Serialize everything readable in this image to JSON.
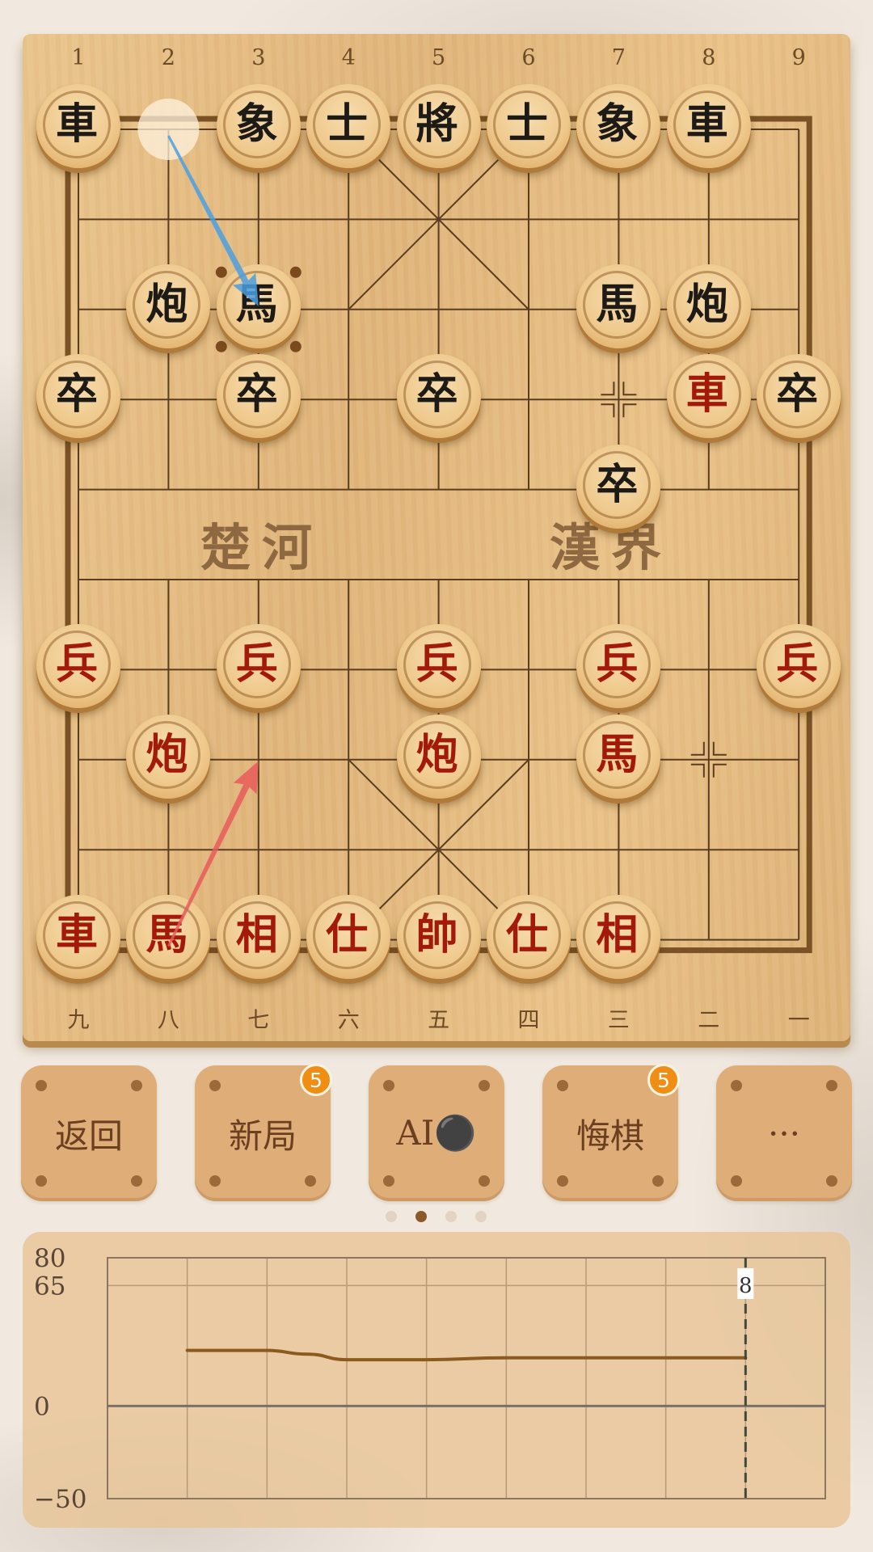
{
  "board": {
    "file_labels_top": [
      "1",
      "2",
      "3",
      "4",
      "5",
      "6",
      "7",
      "8",
      "9"
    ],
    "file_labels_bottom": [
      "九",
      "八",
      "七",
      "六",
      "五",
      "四",
      "三",
      "二",
      "一"
    ],
    "river_left": "楚河",
    "river_right": "漢界",
    "pieces": [
      {
        "char": "車",
        "side": "black",
        "file": 0,
        "rank": 0
      },
      {
        "char": "象",
        "side": "black",
        "file": 2,
        "rank": 0
      },
      {
        "char": "士",
        "side": "black",
        "file": 3,
        "rank": 0
      },
      {
        "char": "將",
        "side": "black",
        "file": 4,
        "rank": 0
      },
      {
        "char": "士",
        "side": "black",
        "file": 5,
        "rank": 0
      },
      {
        "char": "象",
        "side": "black",
        "file": 6,
        "rank": 0
      },
      {
        "char": "車",
        "side": "black",
        "file": 7,
        "rank": 0
      },
      {
        "char": "炮",
        "side": "black",
        "file": 1,
        "rank": 2
      },
      {
        "char": "馬",
        "side": "black",
        "file": 2,
        "rank": 2
      },
      {
        "char": "馬",
        "side": "black",
        "file": 6,
        "rank": 2
      },
      {
        "char": "炮",
        "side": "black",
        "file": 7,
        "rank": 2
      },
      {
        "char": "卒",
        "side": "black",
        "file": 0,
        "rank": 3
      },
      {
        "char": "卒",
        "side": "black",
        "file": 2,
        "rank": 3
      },
      {
        "char": "卒",
        "side": "black",
        "file": 4,
        "rank": 3
      },
      {
        "char": "車",
        "side": "red-black",
        "file": 7,
        "rank": 3
      },
      {
        "char": "卒",
        "side": "black",
        "file": 8,
        "rank": 3
      },
      {
        "char": "卒",
        "side": "black",
        "file": 6,
        "rank": 4
      },
      {
        "char": "兵",
        "side": "red",
        "file": 0,
        "rank": 6
      },
      {
        "char": "兵",
        "side": "red",
        "file": 2,
        "rank": 6
      },
      {
        "char": "兵",
        "side": "red",
        "file": 4,
        "rank": 6
      },
      {
        "char": "兵",
        "side": "red",
        "file": 6,
        "rank": 6
      },
      {
        "char": "兵",
        "side": "red",
        "file": 8,
        "rank": 6
      },
      {
        "char": "炮",
        "side": "red",
        "file": 1,
        "rank": 7
      },
      {
        "char": "炮",
        "side": "red",
        "file": 4,
        "rank": 7
      },
      {
        "char": "馬",
        "side": "red",
        "file": 6,
        "rank": 7
      },
      {
        "char": "車",
        "side": "red",
        "file": 0,
        "rank": 9
      },
      {
        "char": "馬",
        "side": "red",
        "file": 1,
        "rank": 9
      },
      {
        "char": "相",
        "side": "red",
        "file": 2,
        "rank": 9
      },
      {
        "char": "仕",
        "side": "red",
        "file": 3,
        "rank": 9
      },
      {
        "char": "帥",
        "side": "red",
        "file": 4,
        "rank": 9
      },
      {
        "char": "仕",
        "side": "red",
        "file": 5,
        "rank": 9
      },
      {
        "char": "相",
        "side": "red",
        "file": 6,
        "rank": 9
      }
    ],
    "last_move_black": {
      "from": [
        1,
        0
      ],
      "to": [
        2,
        2
      ],
      "color": "#4a9fe0"
    },
    "last_move_red": {
      "from": [
        1,
        9
      ],
      "to": [
        2,
        7
      ],
      "color": "#e85a5a"
    },
    "selected": [
      2,
      2
    ],
    "empty_markers": [
      [
        6,
        3
      ],
      [
        7,
        7
      ]
    ]
  },
  "buttons": [
    {
      "label": "返回",
      "badge": ""
    },
    {
      "label": "新局",
      "badge": "5"
    },
    {
      "label": "AI⚫",
      "badge": ""
    },
    {
      "label": "悔棋",
      "badge": "5"
    },
    {
      "label": "···",
      "badge": ""
    }
  ],
  "page_dots": {
    "count": 4,
    "active": 1
  },
  "chart_data": {
    "type": "line",
    "title": "",
    "xlabel": "",
    "ylabel": "",
    "y_tick_labels": [
      "80",
      "65",
      "0",
      "−50"
    ],
    "y_ticks": [
      80,
      65,
      0,
      -50
    ],
    "ylim": [
      -50,
      80
    ],
    "xlim": [
      0,
      9
    ],
    "grid": true,
    "x": [
      1,
      2,
      2.5,
      3,
      4,
      5,
      6,
      7,
      8
    ],
    "values": [
      30,
      30,
      28,
      25,
      25,
      26,
      26,
      26,
      26
    ],
    "marker_x": 8,
    "marker_label": "8",
    "line_color": "#8b5a1e"
  }
}
